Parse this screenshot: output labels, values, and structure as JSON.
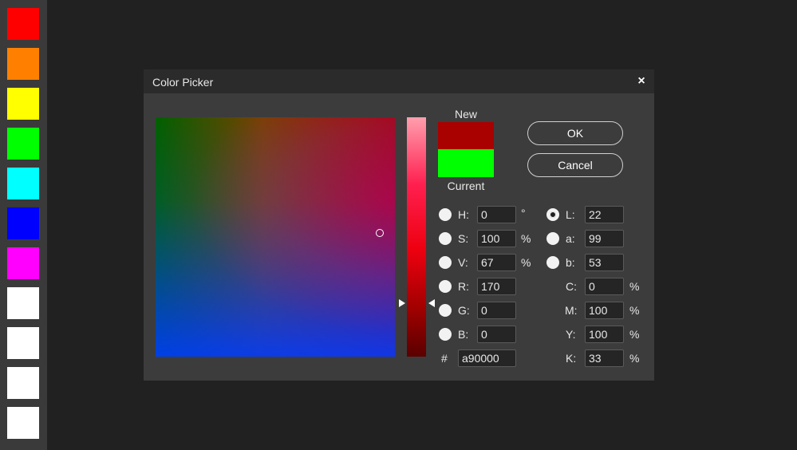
{
  "swatches": [
    {
      "name": "swatch-red",
      "color": "#ff0000"
    },
    {
      "name": "swatch-orange",
      "color": "#ff8000"
    },
    {
      "name": "swatch-yellow",
      "color": "#ffff00"
    },
    {
      "name": "swatch-green",
      "color": "#00ff00"
    },
    {
      "name": "swatch-cyan",
      "color": "#00ffff"
    },
    {
      "name": "swatch-blue",
      "color": "#0000ff"
    },
    {
      "name": "swatch-magenta",
      "color": "#ff00ff"
    },
    {
      "name": "swatch-white-1",
      "color": "#ffffff"
    },
    {
      "name": "swatch-white-2",
      "color": "#ffffff"
    },
    {
      "name": "swatch-white-3",
      "color": "#ffffff"
    },
    {
      "name": "swatch-white-4",
      "color": "#ffffff"
    }
  ],
  "dialog": {
    "title": "Color Picker",
    "close_icon": "×",
    "new_label": "New",
    "current_label": "Current",
    "new_color": "#a90000",
    "current_color": "#00ff00",
    "ok_label": "OK",
    "cancel_label": "Cancel"
  },
  "hsv": {
    "h": {
      "label": "H:",
      "value": "0",
      "unit": "°"
    },
    "s": {
      "label": "S:",
      "value": "100",
      "unit": "%"
    },
    "v": {
      "label": "V:",
      "value": "67",
      "unit": "%"
    }
  },
  "rgb": {
    "r": {
      "label": "R:",
      "value": "170"
    },
    "g": {
      "label": "G:",
      "value": "0"
    },
    "b": {
      "label": "B:",
      "value": "0"
    }
  },
  "hex": {
    "label": "#",
    "value": "a90000"
  },
  "lab": {
    "l": {
      "label": "L:",
      "value": "22"
    },
    "a": {
      "label": "a:",
      "value": "99"
    },
    "b": {
      "label": "b:",
      "value": "53"
    }
  },
  "cmyk": {
    "c": {
      "label": "C:",
      "value": "0",
      "unit": "%"
    },
    "m": {
      "label": "M:",
      "value": "100",
      "unit": "%"
    },
    "y": {
      "label": "Y:",
      "value": "100",
      "unit": "%"
    },
    "k": {
      "label": "K:",
      "value": "33",
      "unit": "%"
    }
  },
  "selected_channel": "L"
}
